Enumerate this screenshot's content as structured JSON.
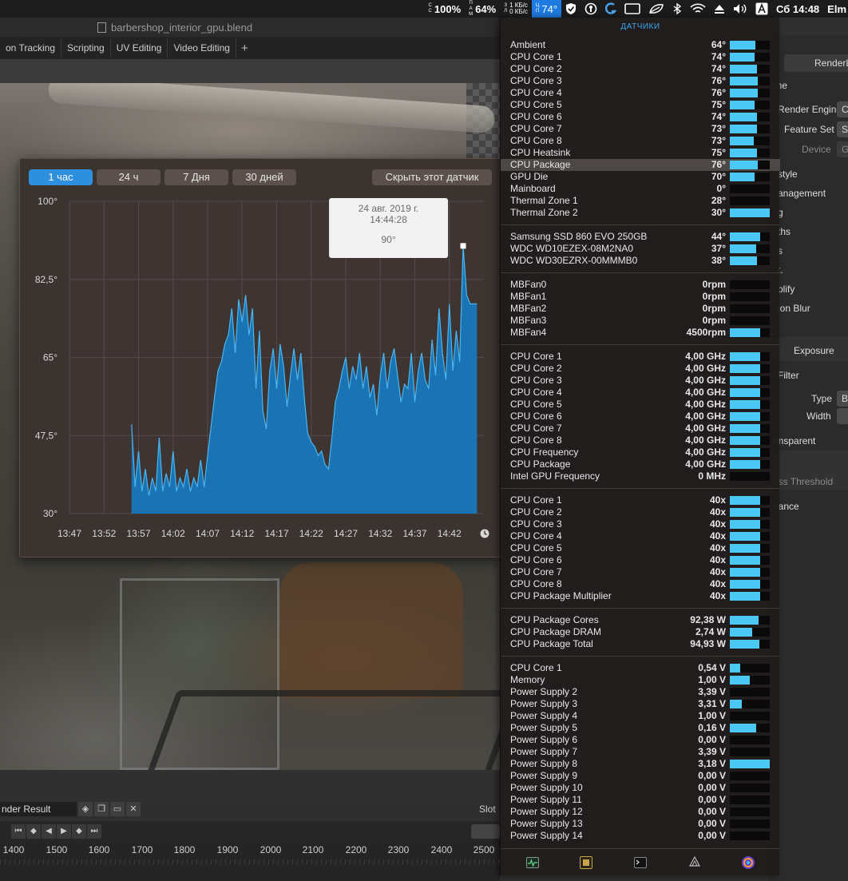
{
  "menubar": {
    "battery_label": "С\nС",
    "battery_pct": "100%",
    "mem_label": "П\nА\nМ",
    "mem_pct": "64%",
    "net_label": "З\nЛ",
    "net_up": "1 КБ/с",
    "net_down": "0 КБ/с",
    "cpu_label": "Ц\nП",
    "cpu_temp": "74°",
    "clock": "Сб 14:48",
    "user": "Elm"
  },
  "blender": {
    "window_title": "barbershop_interior_gpu.blend",
    "workspace_tabs": [
      "on Tracking",
      "Scripting",
      "UV Editing",
      "Video Editing"
    ],
    "add_workspace": "+",
    "render_result": "nder Result",
    "slot": "Slot",
    "ruler_ticks": [
      "1400",
      "1500",
      "1600",
      "1700",
      "1800",
      "1900",
      "2000",
      "2100",
      "2200",
      "2300",
      "2400",
      "2500"
    ],
    "properties": {
      "renderer": "RenderL",
      "scene": "ene",
      "render_engine_label": "Render Engine",
      "render_engine_value": "C",
      "feature_set_label": "Feature Set",
      "feature_set_value": "S",
      "device_label": "Device",
      "device_value": "G",
      "items": [
        "style",
        "anagement",
        "g",
        "ths",
        "s",
        "t.",
        "plify",
        "ion Blur"
      ],
      "exposure_label": "Exposure",
      "filter": "Filter",
      "type_label": "Type",
      "type_value": "B",
      "width_label": "Width",
      "transparent": "ansparent",
      "threshold": "ess Threshold",
      "performance": "nance"
    }
  },
  "chart_window": {
    "tabs": [
      {
        "label": "1 час",
        "active": true
      },
      {
        "label": "24 ч",
        "active": false
      },
      {
        "label": "7 Дня",
        "active": false
      },
      {
        "label": "30 дней",
        "active": false
      }
    ],
    "hide_button": "Скрыть этот датчик",
    "tooltip": {
      "date": "24 авг. 2019 г.",
      "time": "14:44:28",
      "value": "90°"
    },
    "clock_icon": "clock-icon"
  },
  "chart_data": {
    "type": "area",
    "title": "",
    "xlabel": "",
    "ylabel": "",
    "ylim": [
      30,
      100
    ],
    "yticks": [
      "100°",
      "82,5°",
      "65°",
      "47,5°",
      "30°"
    ],
    "ytick_values": [
      100,
      82.5,
      65,
      47.5,
      30
    ],
    "xlim": [
      "13:47",
      "14:47"
    ],
    "xticks": [
      "13:47",
      "13:52",
      "13:57",
      "14:02",
      "14:07",
      "14:12",
      "14:17",
      "14:22",
      "14:27",
      "14:32",
      "14:37",
      "14:42"
    ],
    "grid": true,
    "color": "#1a73b2",
    "line_color": "#49b6f2",
    "series": [
      {
        "x": [
          "13:56",
          "13:56",
          "13:57",
          "13:57",
          "13:58",
          "13:58",
          "13:59",
          "13:59",
          "14:00",
          "14:00",
          "14:01",
          "14:01",
          "14:02",
          "14:02",
          "14:03",
          "14:03",
          "14:04",
          "14:04",
          "14:05",
          "14:05",
          "14:06",
          "14:06",
          "14:07",
          "14:08",
          "14:08",
          "14:09",
          "14:09",
          "14:10",
          "14:10",
          "14:11",
          "14:11",
          "14:12",
          "14:12",
          "14:13",
          "14:13",
          "14:14",
          "14:14",
          "14:15",
          "14:15",
          "14:16",
          "14:16",
          "14:17",
          "14:17",
          "14:18",
          "14:18",
          "14:19",
          "14:19",
          "14:20",
          "14:20",
          "14:21",
          "14:21",
          "14:22",
          "14:22",
          "14:23",
          "14:23",
          "14:24",
          "14:24",
          "14:25",
          "14:25",
          "14:26",
          "14:26",
          "14:27",
          "14:27",
          "14:28",
          "14:28",
          "14:29",
          "14:29",
          "14:30",
          "14:30",
          "14:31",
          "14:31",
          "14:32",
          "14:32",
          "14:33",
          "14:33",
          "14:34",
          "14:34",
          "14:35",
          "14:35",
          "14:36",
          "14:36",
          "14:37",
          "14:37",
          "14:38",
          "14:38",
          "14:39",
          "14:39",
          "14:40",
          "14:40",
          "14:41",
          "14:41",
          "14:42",
          "14:42",
          "14:43",
          "14:43",
          "14:44",
          "14:44",
          "14:45",
          "14:45",
          "14:46"
        ],
        "values": [
          50,
          36,
          44,
          35,
          40,
          34,
          38,
          35,
          47,
          35,
          39,
          36,
          44,
          35,
          38,
          36,
          40,
          35,
          38,
          36,
          42,
          36,
          43,
          56,
          62,
          64,
          68,
          70,
          76,
          66,
          78,
          73,
          79,
          70,
          76,
          58,
          71,
          53,
          49,
          62,
          67,
          58,
          68,
          63,
          54,
          61,
          67,
          60,
          66,
          56,
          48,
          46,
          45,
          43,
          44,
          41,
          40,
          47,
          55,
          58,
          62,
          65,
          58,
          63,
          60,
          66,
          58,
          63,
          56,
          59,
          52,
          61,
          66,
          58,
          64,
          67,
          61,
          55,
          59,
          58,
          66,
          55,
          62,
          66,
          60,
          58,
          69,
          61,
          76,
          66,
          60,
          77,
          62,
          71,
          64,
          90,
          79,
          77,
          77,
          77
        ]
      }
    ]
  },
  "sensors": {
    "title": "ДАТЧИКИ",
    "groups": [
      {
        "rows": [
          {
            "name": "Ambient",
            "value": "64°",
            "fill": 0.64
          },
          {
            "name": "CPU Core 1",
            "value": "74°",
            "fill": 0.62
          },
          {
            "name": "CPU Core 2",
            "value": "74°",
            "fill": 0.68
          },
          {
            "name": "CPU Core 3",
            "value": "76°",
            "fill": 0.7
          },
          {
            "name": "CPU Core 4",
            "value": "76°",
            "fill": 0.7
          },
          {
            "name": "CPU Core 5",
            "value": "75°",
            "fill": 0.62
          },
          {
            "name": "CPU Core 6",
            "value": "74°",
            "fill": 0.68
          },
          {
            "name": "CPU Core 7",
            "value": "73°",
            "fill": 0.68
          },
          {
            "name": "CPU Core 8",
            "value": "73°",
            "fill": 0.6
          },
          {
            "name": "CPU Heatsink",
            "value": "75°",
            "fill": 0.68
          },
          {
            "name": "CPU Package",
            "value": "76°",
            "fill": 0.7,
            "highlight": true
          },
          {
            "name": "GPU Die",
            "value": "70°",
            "fill": 0.62
          },
          {
            "name": "Mainboard",
            "value": "0°",
            "fill": 0.0
          },
          {
            "name": "Thermal Zone 1",
            "value": "28°",
            "fill": 0.0
          },
          {
            "name": "Thermal Zone 2",
            "value": "30°",
            "fill": 1.0
          }
        ]
      },
      {
        "rows": [
          {
            "name": "Samsung SSD 860 EVO 250GB",
            "value": "44°",
            "fill": 0.76
          },
          {
            "name": "WDC WD10EZEX-08M2NA0",
            "value": "37°",
            "fill": 0.66
          },
          {
            "name": "WDC WD30EZRX-00MMMB0",
            "value": "38°",
            "fill": 0.68
          }
        ]
      },
      {
        "rows": [
          {
            "name": "MBFan0",
            "value": "0rpm",
            "fill": 0.0
          },
          {
            "name": "MBFan1",
            "value": "0rpm",
            "fill": 0.0
          },
          {
            "name": "MBFan2",
            "value": "0rpm",
            "fill": 0.0
          },
          {
            "name": "MBFan3",
            "value": "0rpm",
            "fill": 0.0
          },
          {
            "name": "MBFan4",
            "value": "4500rpm",
            "fill": 0.76
          }
        ]
      },
      {
        "rows": [
          {
            "name": "CPU Core 1",
            "value": "4,00 GHz",
            "fill": 0.76
          },
          {
            "name": "CPU Core 2",
            "value": "4,00 GHz",
            "fill": 0.76
          },
          {
            "name": "CPU Core 3",
            "value": "4,00 GHz",
            "fill": 0.76
          },
          {
            "name": "CPU Core 4",
            "value": "4,00 GHz",
            "fill": 0.76
          },
          {
            "name": "CPU Core 5",
            "value": "4,00 GHz",
            "fill": 0.76
          },
          {
            "name": "CPU Core 6",
            "value": "4,00 GHz",
            "fill": 0.76
          },
          {
            "name": "CPU Core 7",
            "value": "4,00 GHz",
            "fill": 0.76
          },
          {
            "name": "CPU Core 8",
            "value": "4,00 GHz",
            "fill": 0.76
          },
          {
            "name": "CPU Frequency",
            "value": "4,00 GHz",
            "fill": 0.76
          },
          {
            "name": "CPU Package",
            "value": "4,00 GHz",
            "fill": 0.76
          },
          {
            "name": "Intel GPU Frequency",
            "value": "0 MHz",
            "fill": 0.0
          }
        ]
      },
      {
        "rows": [
          {
            "name": "CPU Core 1",
            "value": "40x",
            "fill": 0.76
          },
          {
            "name": "CPU Core 2",
            "value": "40x",
            "fill": 0.76
          },
          {
            "name": "CPU Core 3",
            "value": "40x",
            "fill": 0.76
          },
          {
            "name": "CPU Core 4",
            "value": "40x",
            "fill": 0.76
          },
          {
            "name": "CPU Core 5",
            "value": "40x",
            "fill": 0.76
          },
          {
            "name": "CPU Core 6",
            "value": "40x",
            "fill": 0.76
          },
          {
            "name": "CPU Core 7",
            "value": "40x",
            "fill": 0.76
          },
          {
            "name": "CPU Core 8",
            "value": "40x",
            "fill": 0.76
          },
          {
            "name": "CPU Package Multiplier",
            "value": "40x",
            "fill": 0.76
          }
        ]
      },
      {
        "rows": [
          {
            "name": "CPU Package Cores",
            "value": "92,38 W",
            "fill": 0.72
          },
          {
            "name": "CPU Package DRAM",
            "value": "2,74 W",
            "fill": 0.56
          },
          {
            "name": "CPU Package Total",
            "value": "94,93 W",
            "fill": 0.74
          }
        ]
      },
      {
        "rows": [
          {
            "name": "CPU Core 1",
            "value": "0,54 V",
            "fill": 0.26
          },
          {
            "name": "Memory",
            "value": "1,00 V",
            "fill": 0.5
          },
          {
            "name": "Power Supply 2",
            "value": "3,39 V",
            "fill": 0.0
          },
          {
            "name": "Power Supply 3",
            "value": "3,31 V",
            "fill": 0.3
          },
          {
            "name": "Power Supply 4",
            "value": "1,00 V",
            "fill": 0.0
          },
          {
            "name": "Power Supply 5",
            "value": "0,16 V",
            "fill": 0.66
          },
          {
            "name": "Power Supply 6",
            "value": "0,00 V",
            "fill": 0.0
          },
          {
            "name": "Power Supply 7",
            "value": "3,39 V",
            "fill": 0.0
          },
          {
            "name": "Power Supply 8",
            "value": "3,18 V",
            "fill": 1.0
          },
          {
            "name": "Power Supply 9",
            "value": "0,00 V",
            "fill": 0.0
          },
          {
            "name": "Power Supply 10",
            "value": "0,00 V",
            "fill": 0.0
          },
          {
            "name": "Power Supply 11",
            "value": "0,00 V",
            "fill": 0.0
          },
          {
            "name": "Power Supply 12",
            "value": "0,00 V",
            "fill": 0.0
          },
          {
            "name": "Power Supply 13",
            "value": "0,00 V",
            "fill": 0.0
          },
          {
            "name": "Power Supply 14",
            "value": "0,00 V",
            "fill": 0.0
          }
        ]
      }
    ],
    "footer_icons": [
      "activity-monitor-icon",
      "system-info-icon",
      "terminal-icon",
      "disk-utility-icon",
      "istat-menus-icon"
    ]
  },
  "colors": {
    "accent": "#2f8fdf",
    "bar_fill": "#4cc8f5",
    "sensors_title": "#3ea3ef"
  }
}
